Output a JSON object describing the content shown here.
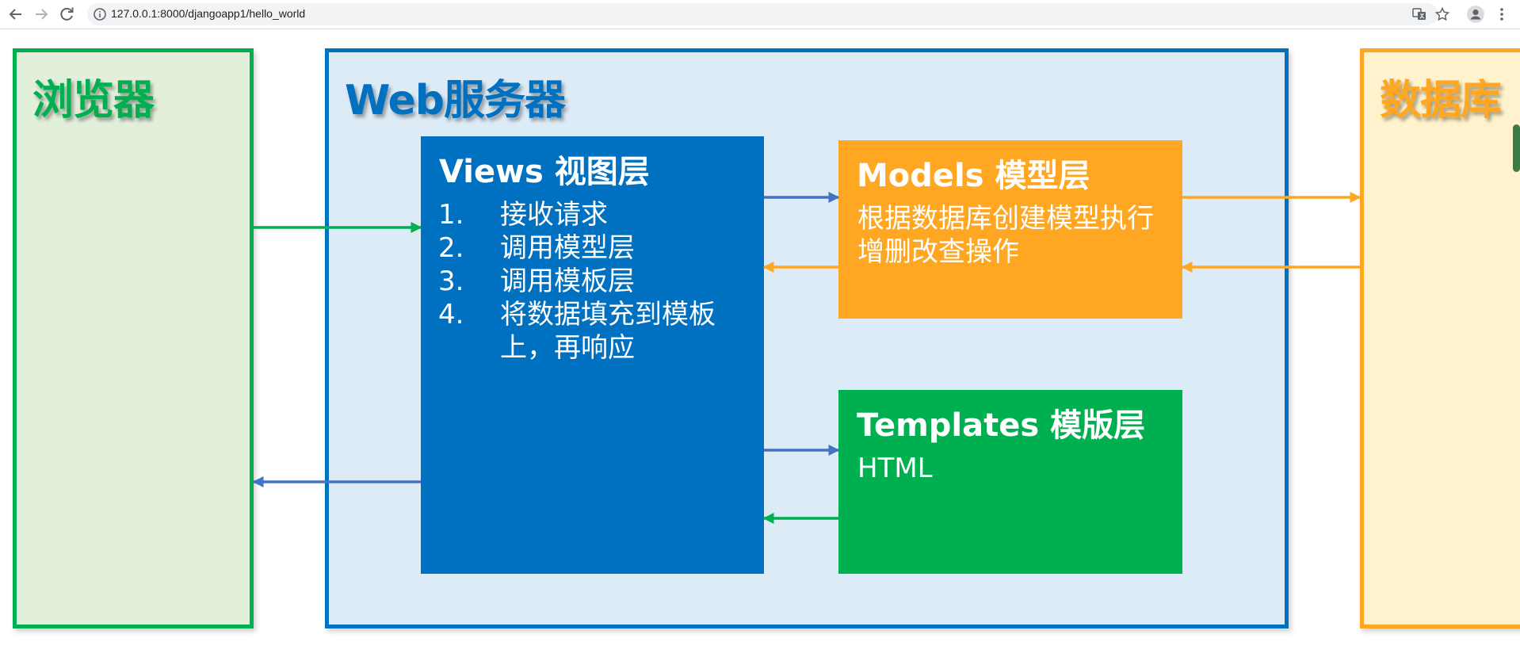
{
  "browser": {
    "url": "127.0.0.1:8000/djangoapp1/hello_world",
    "icons": [
      "back-icon",
      "forward-icon",
      "reload-icon",
      "info-icon",
      "translate-icon",
      "star-icon",
      "avatar-icon",
      "menu-icon"
    ]
  },
  "diagram": {
    "browser_panel": {
      "title": "浏览器"
    },
    "server_panel": {
      "title": "Web服务器"
    },
    "database_panel": {
      "title": "数据库"
    },
    "views": {
      "title": "Views 视图层",
      "steps": [
        {
          "num": "1.",
          "text": "接收请求"
        },
        {
          "num": "2.",
          "text": "调用模型层"
        },
        {
          "num": "3.",
          "text": "调用模板层"
        },
        {
          "num": "4.",
          "text": "将数据填充到模板上，再响应"
        }
      ]
    },
    "models": {
      "title": "Models 模型层",
      "desc": "根据数据库创建模型执行增删改查操作"
    },
    "templates": {
      "title": "Templates 模版层",
      "desc": "HTML"
    }
  },
  "colors": {
    "green": "#00b050",
    "blue": "#0070c0",
    "orange": "#ffa722",
    "arrow_blue": "#4472c4",
    "light_green": "#e2efda",
    "light_blue": "#ddebf7",
    "light_yellow": "#fff2cc"
  }
}
